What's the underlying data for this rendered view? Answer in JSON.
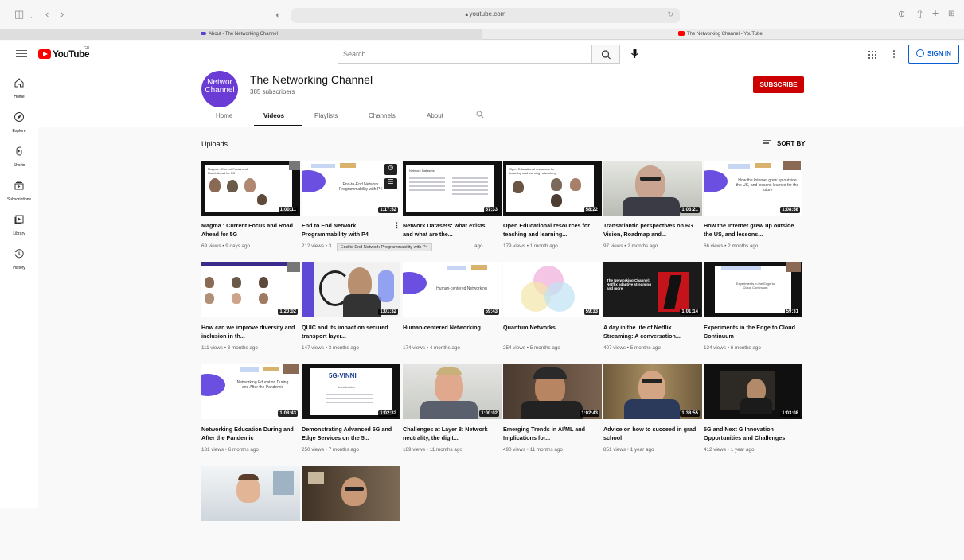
{
  "browser": {
    "address": "youtube.com",
    "tabs": [
      {
        "label": "About - The Networking Channel"
      },
      {
        "label": "The Networking Channel - YouTube"
      }
    ]
  },
  "header": {
    "logo_text": "YouTube",
    "region": "GR",
    "search_placeholder": "Search",
    "sign_in_label": "SIGN IN"
  },
  "sidebar": {
    "items": [
      {
        "label": "Home",
        "icon": "home-icon"
      },
      {
        "label": "Explore",
        "icon": "compass-icon"
      },
      {
        "label": "Shorts",
        "icon": "shorts-icon"
      },
      {
        "label": "Subscriptions",
        "icon": "subscriptions-icon"
      },
      {
        "label": "Library",
        "icon": "library-icon"
      },
      {
        "label": "History",
        "icon": "history-icon"
      }
    ]
  },
  "channel": {
    "avatar_line1": "Networ",
    "avatar_line2": "Channel",
    "title": "The Networking Channel",
    "subscribers": "385 subscribers",
    "subscribe_label": "SUBSCRIBE",
    "tabs": [
      "Home",
      "Videos",
      "Playlists",
      "Channels",
      "About"
    ],
    "active_tab": "Videos"
  },
  "uploads": {
    "heading": "Uploads",
    "sort_label": "SORT BY",
    "tooltip": "End to End Network Programmability with P4",
    "videos": [
      {
        "title": "Magma : Current Focus and Road Ahead for 5G",
        "meta": "69 views • 9 days ago",
        "duration": "1:00:11"
      },
      {
        "title": "End to End Network Programmability with P4",
        "meta": "212 views • 3",
        "duration": "1:17:52"
      },
      {
        "title": "Network Datasets: what exists, and what are the...",
        "meta": "ago",
        "duration": "57:33"
      },
      {
        "title": "Open Educational resources for teaching and learning...",
        "meta": "179 views • 1 month ago",
        "duration": "58:22"
      },
      {
        "title": "Transatlantic perspectives on 6G Vision, Roadmap and...",
        "meta": "97 views • 2 months ago",
        "duration": "1:03:21"
      },
      {
        "title": "How the Internet grew up outside the US, and lessons...",
        "meta": "66 views • 2 months ago",
        "duration": "1:08:58"
      },
      {
        "title": "How can we improve diversity and inclusion in th...",
        "meta": "111 views • 3 months ago",
        "duration": "1:20:02"
      },
      {
        "title": "QUIC and its impact on secured transport layer...",
        "meta": "147 views • 3 months ago",
        "duration": "1:01:32"
      },
      {
        "title": "Human-centered Networking",
        "meta": "174 views • 4 months ago",
        "duration": "59:43"
      },
      {
        "title": "Quantum Networks",
        "meta": "254 views • 5 months ago",
        "duration": "59:33"
      },
      {
        "title": "A day in the life of Netflix Streaming: A conversation...",
        "meta": "407 views • 5 months ago",
        "duration": "1:01:14"
      },
      {
        "title": "Experiments in the Edge to Cloud Continuum",
        "meta": "134 views • 6 months ago",
        "duration": "59:31"
      },
      {
        "title": "Networking Education During and After the Pandemic",
        "meta": "131 views • 6 months ago",
        "duration": "1:08:43"
      },
      {
        "title": "Demonstrating Advanced 5G and Edge Services on the 5...",
        "meta": "250 views • 7 months ago",
        "duration": "1:02:32"
      },
      {
        "title": "Challenges at Layer 8: Network neutrality, the digit...",
        "meta": "189 views • 11 months ago",
        "duration": "1:00:02"
      },
      {
        "title": "Emerging Trends in AI/ML and Implications for...",
        "meta": "490 views • 11 months ago",
        "duration": "1:02:43"
      },
      {
        "title": "Advice on how to succeed in grad school",
        "meta": "851 views • 1 year ago",
        "duration": "1:38:55"
      },
      {
        "title": "5G and Next G Innovation Opportunities and Challenges",
        "meta": "412 views • 1 year ago",
        "duration": "1:03:08"
      },
      {
        "title": "",
        "meta": "",
        "duration": ""
      },
      {
        "title": "",
        "meta": "",
        "duration": ""
      }
    ]
  },
  "thumb_text": {
    "v1": "Magma - Current Focus and Road Ahead for 5G",
    "v2": "End-to-End Network Programmability with P4",
    "v3": "Network Datasets",
    "v4": "Open Educational resources for teaching and learning networking",
    "v6": "How the Internet grew up outside the US, and lessons learned for the future",
    "v9": "Human-centered Networking",
    "v11": "The Networking Channel: Netflix adaptive streaming and more",
    "v12": "Experiments in the Edge to Cloud Continuum",
    "v13": "Networking Education During and After the Pandemic",
    "v14": "5G-VINNI",
    "v14b": "Introduction"
  }
}
